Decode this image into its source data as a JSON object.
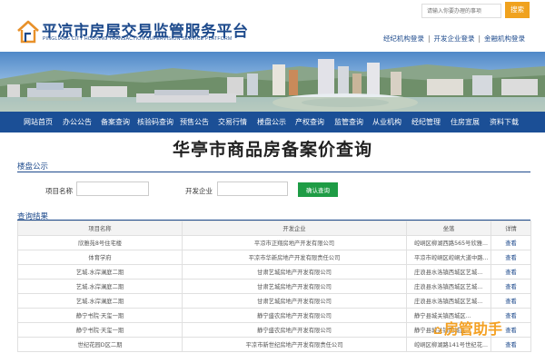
{
  "site": {
    "title": "平凉市房屋交易监管服务平台",
    "subtitle": "PINGLIANG CITY HOUSING TRANSACTION SUPERVISION SERVICE PLATFORM"
  },
  "search": {
    "placeholder": "请输入你要办理的事项",
    "button": "搜索"
  },
  "quick_links": [
    "经纪机构登录",
    "开发企业登录",
    "金融机构登录"
  ],
  "nav": [
    "网站首页",
    "办公公告",
    "备案查询",
    "核验码查询",
    "预售公告",
    "交易行情",
    "楼盘公示",
    "产权查询",
    "监管查询",
    "从业机构",
    "经纪管理",
    "住房宣展",
    "资料下载"
  ],
  "page_title": "华亭市商品房备案价查询",
  "section_title": "楼盘公示",
  "form": {
    "project_label": "项目名称",
    "developer_label": "开发企业",
    "query_button": "确认查询"
  },
  "results_title": "查询结果",
  "table": {
    "headers": [
      "项目名称",
      "开发企业",
      "坐落",
      "详情"
    ],
    "rows": [
      [
        "欣雅苑8号住宅楼",
        "平凉市正翔房地产开发有限公司",
        "崆峒区柳湖西路565号欣雅...",
        "查看"
      ],
      [
        "体育学府",
        "平凉市华新房地产开发有限责任公司",
        "平凉市崆峒区崆峒大道中路...",
        "查看"
      ],
      [
        "艺城.水岸澜庭二期",
        "甘肃艺城房地产开发有限公司",
        "庄浪县水洛镇西城区艺城...",
        "查看"
      ],
      [
        "艺城.水岸澜庭二期",
        "甘肃艺城房地产开发有限公司",
        "庄浪县水洛镇西城区艺城...",
        "查看"
      ],
      [
        "艺城.水岸澜庭二期",
        "甘肃艺城房地产开发有限公司",
        "庄浪县水洛镇西城区艺城...",
        "查看"
      ],
      [
        "静宁书院·天玺一期",
        "静宁盛农房地产开发有限公司",
        "静宁县城关镇西城区...",
        "查看"
      ],
      [
        "静宁书院·天玺一期",
        "静宁盛农房地产开发有限公司",
        "静宁县城关镇西城区...",
        "查看"
      ],
      [
        "世纪花园D区二期",
        "平凉市新世纪房地产开发有限责任公司",
        "崆峒区柳湖路141号世纪花...",
        "查看"
      ]
    ]
  },
  "watermark": "房管助手",
  "colors": {
    "brand_blue": "#1b4f96",
    "search_orange": "#f0a21e",
    "query_green": "#1e9c45",
    "watermark_orange": "#f4a124"
  }
}
